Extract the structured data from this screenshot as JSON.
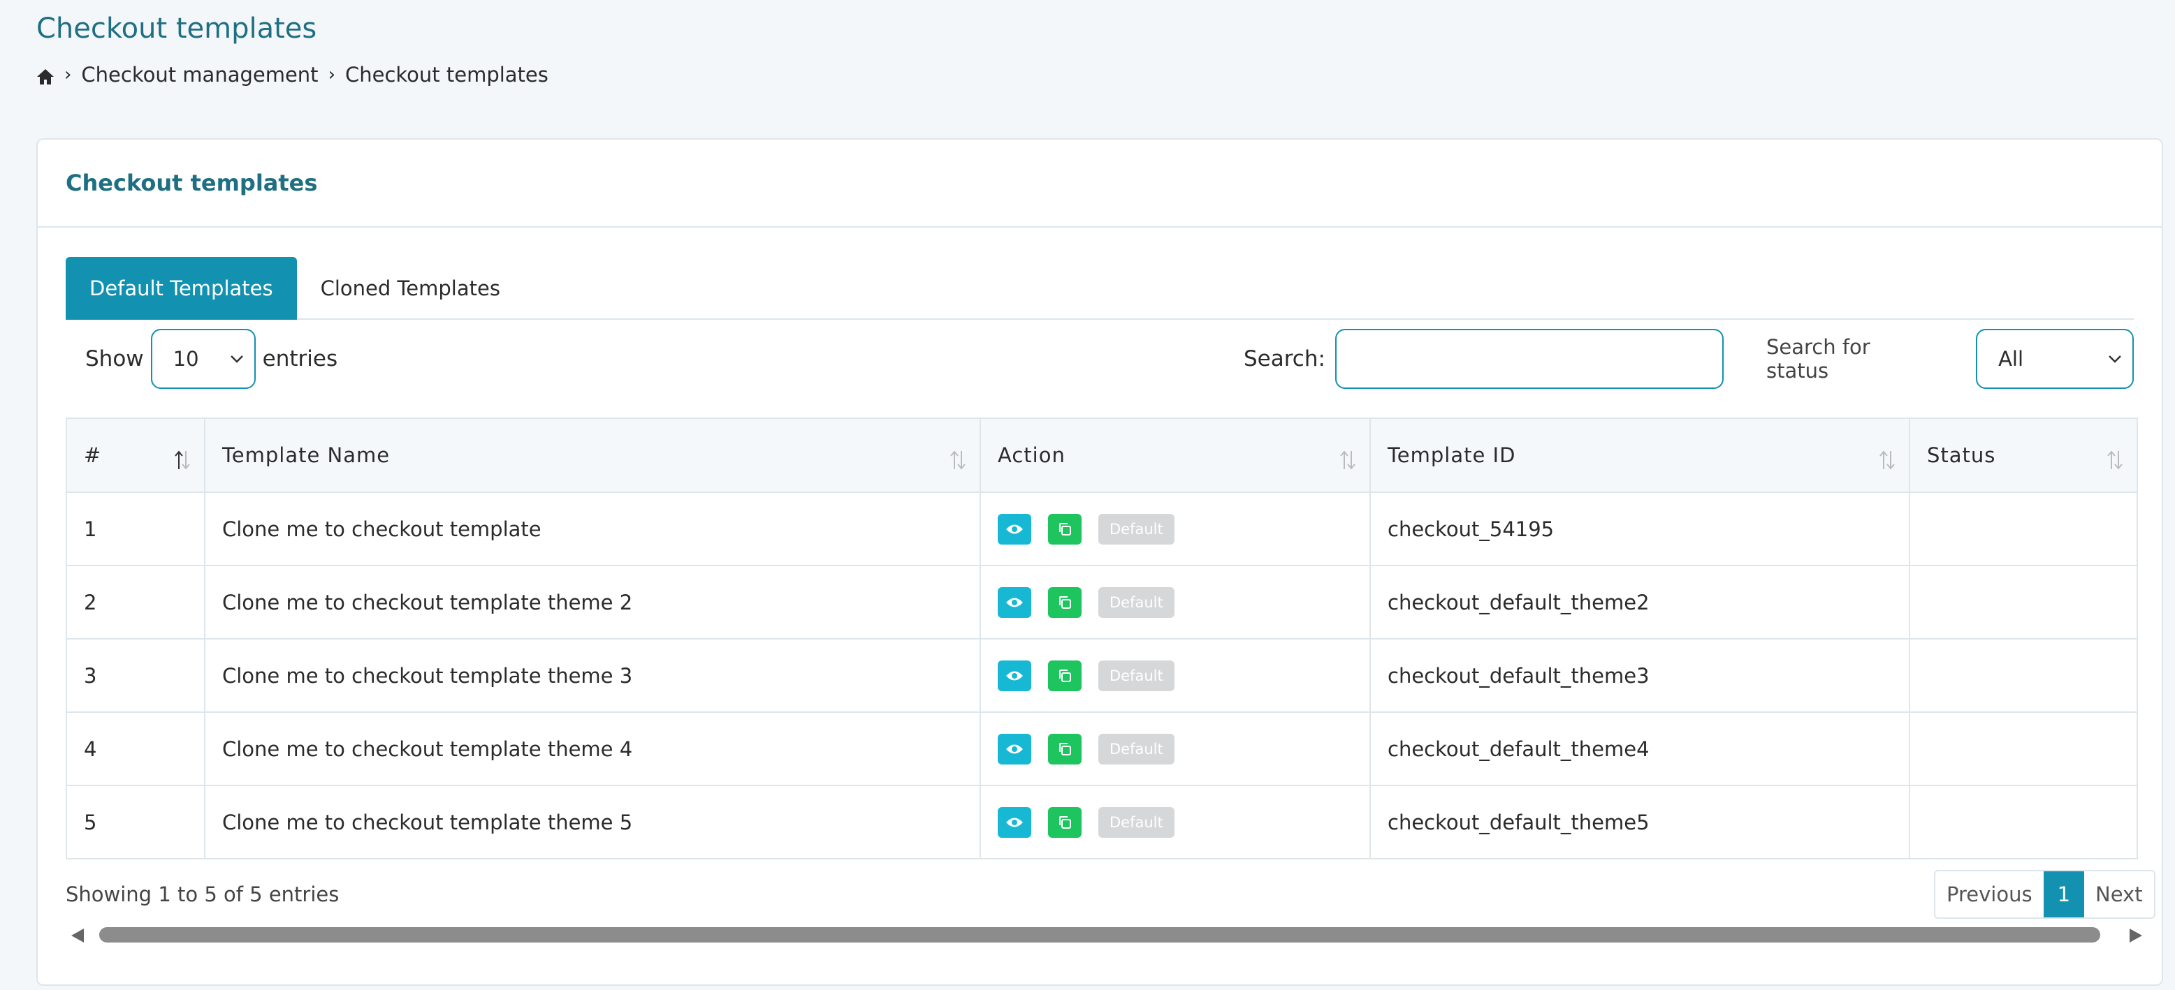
{
  "page": {
    "title": "Checkout templates"
  },
  "breadcrumb": {
    "items": [
      "Checkout management",
      "Checkout templates"
    ]
  },
  "card": {
    "title": "Checkout templates"
  },
  "tabs": [
    {
      "label": "Default Templates",
      "active": true
    },
    {
      "label": "Cloned Templates",
      "active": false
    }
  ],
  "length": {
    "show_label": "Show",
    "value": "10",
    "entries_label": "entries"
  },
  "search": {
    "label": "Search:",
    "value": "",
    "placeholder": ""
  },
  "status_filter": {
    "label": "Search for status",
    "value": "All"
  },
  "table": {
    "columns": [
      "#",
      "Template Name",
      "Action",
      "Template ID",
      "Status"
    ],
    "rows": [
      {
        "num": "1",
        "name": "Clone me to checkout template",
        "badge": "Default",
        "id": "checkout_54195",
        "status": ""
      },
      {
        "num": "2",
        "name": "Clone me to checkout template theme 2",
        "badge": "Default",
        "id": "checkout_default_theme2",
        "status": ""
      },
      {
        "num": "3",
        "name": "Clone me to checkout template theme 3",
        "badge": "Default",
        "id": "checkout_default_theme3",
        "status": ""
      },
      {
        "num": "4",
        "name": "Clone me to checkout template theme 4",
        "badge": "Default",
        "id": "checkout_default_theme4",
        "status": ""
      },
      {
        "num": "5",
        "name": "Clone me to checkout template theme 5",
        "badge": "Default",
        "id": "checkout_default_theme5",
        "status": ""
      }
    ]
  },
  "info": {
    "text": "Showing 1 to 5 of 5 entries"
  },
  "pagination": {
    "previous": "Previous",
    "current": "1",
    "next": "Next"
  },
  "colors": {
    "accent": "#1291b1",
    "title": "#1f6f82",
    "view": "#16b8d4",
    "clone": "#1ec45e",
    "badge": "#d5d7d9"
  },
  "icons": {
    "home": "home-icon",
    "view": "eye-icon",
    "clone": "copy-icon",
    "sort": "sort-icon",
    "chevron": "chevron-down-icon"
  }
}
